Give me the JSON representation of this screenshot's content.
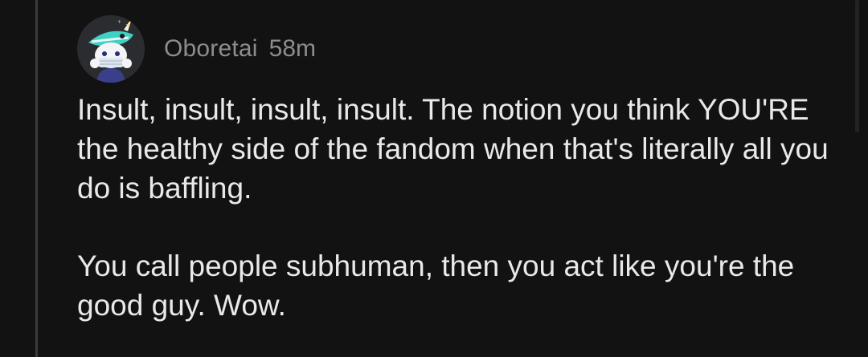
{
  "comment": {
    "username": "Oboretai",
    "timestamp": "58m",
    "avatar_icon": "snoo-avatar-with-unicorn-hat-icon",
    "paragraphs": [
      "Insult, insult, insult, insult. The notion you think YOU'RE the healthy side of the fandom when that's literally all you do is baffling.",
      "You call people subhuman, then you act like you're the good guy. Wow."
    ]
  },
  "colors": {
    "background": "#121213",
    "thread_line": "#3b3b3d",
    "username": "#8b8d90",
    "body_text": "#e9e9ea"
  }
}
